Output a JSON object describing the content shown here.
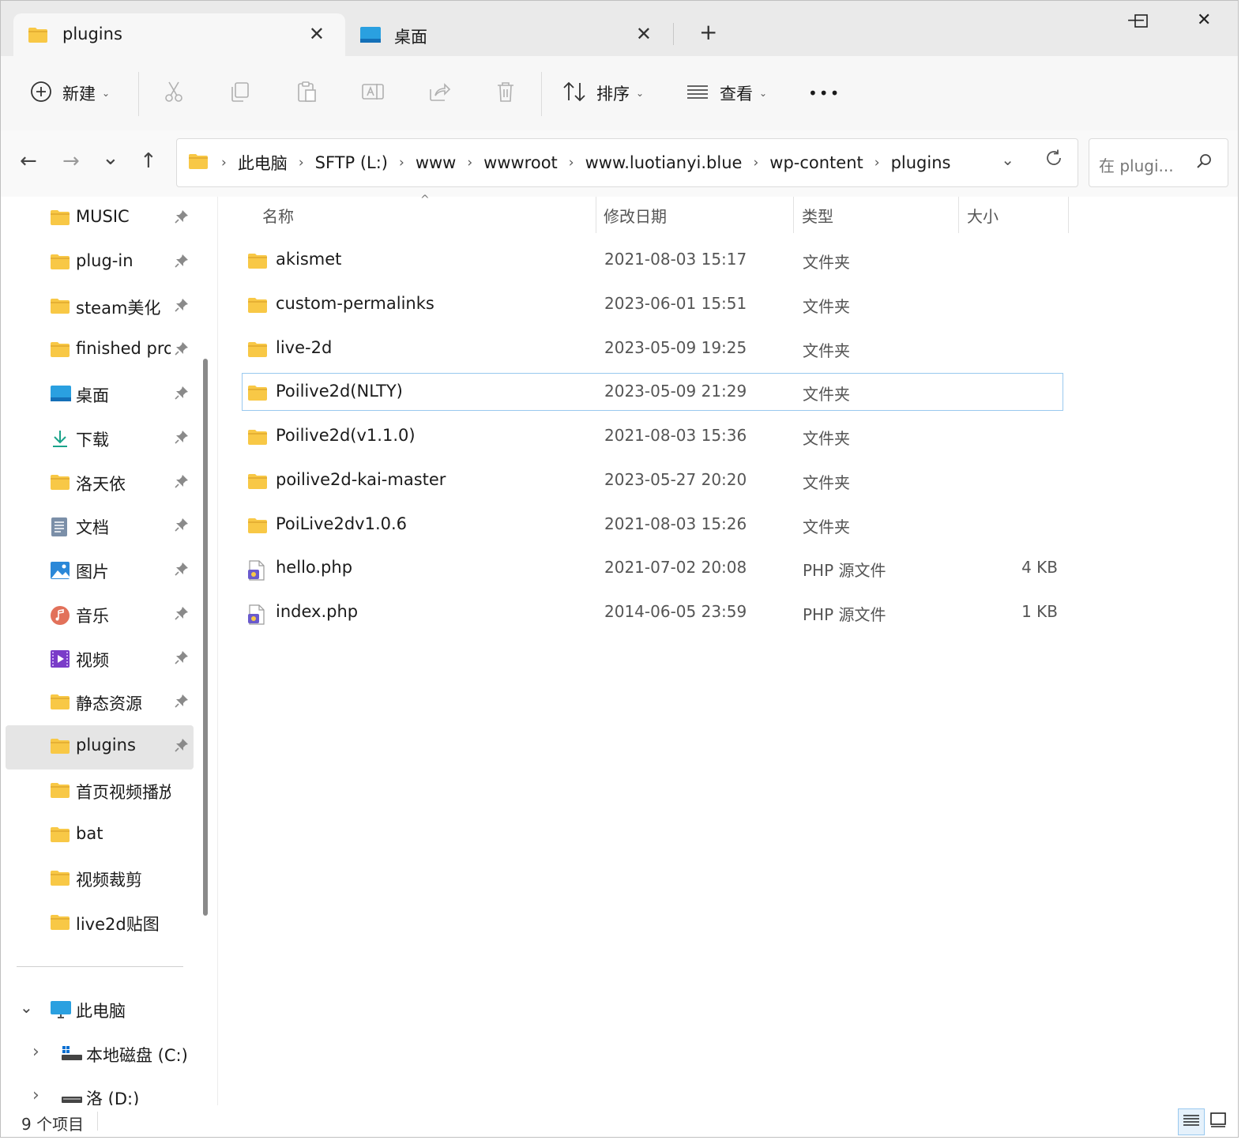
{
  "tabs": [
    {
      "label": "plugins",
      "close": "✕"
    },
    {
      "label": "桌面",
      "close": "✕"
    }
  ],
  "new_tab": "+",
  "window_controls": {
    "minimize": "—",
    "maximize": "☐",
    "close": "✕"
  },
  "toolbar": {
    "new_label": "新建",
    "sort_label": "排序",
    "view_label": "查看",
    "more": "•••",
    "icons": [
      "plus-circle-icon",
      "cut-icon",
      "copy-icon",
      "paste-icon",
      "rename-icon",
      "share-icon",
      "delete-icon"
    ]
  },
  "nav": {
    "back": "←",
    "forward": "→",
    "recent": "⌄",
    "up": "↑"
  },
  "breadcrumb": [
    "此电脑",
    "SFTP (L:)",
    "www",
    "wwwroot",
    "www.luotianyi.blue",
    "wp-content",
    "plugins"
  ],
  "search": {
    "placeholder": "在 plugi..."
  },
  "sidebar": {
    "quick_access": [
      {
        "label": "MUSIC",
        "icon": "folder-icon",
        "pinned": true
      },
      {
        "label": "plug-in",
        "icon": "folder-icon",
        "pinned": true
      },
      {
        "label": "steam美化",
        "icon": "folder-icon",
        "pinned": true
      },
      {
        "label": "finished proj",
        "icon": "folder-icon",
        "pinned": true
      },
      {
        "label": "桌面",
        "icon": "desktop-icon",
        "pinned": true
      },
      {
        "label": "下载",
        "icon": "download-icon",
        "pinned": true
      },
      {
        "label": "洛天依",
        "icon": "folder-icon",
        "pinned": true
      },
      {
        "label": "文档",
        "icon": "document-icon",
        "pinned": true
      },
      {
        "label": "图片",
        "icon": "pictures-icon",
        "pinned": true
      },
      {
        "label": "音乐",
        "icon": "music-icon",
        "pinned": true
      },
      {
        "label": "视频",
        "icon": "video-icon",
        "pinned": true
      },
      {
        "label": "静态资源",
        "icon": "folder-icon",
        "pinned": true
      },
      {
        "label": "plugins",
        "icon": "folder-icon",
        "pinned": true,
        "selected": true
      },
      {
        "label": "首页视频播放",
        "icon": "folder-icon",
        "pinned": false
      },
      {
        "label": "bat",
        "icon": "folder-icon",
        "pinned": false
      },
      {
        "label": "视频裁剪",
        "icon": "folder-icon",
        "pinned": false
      },
      {
        "label": "live2d贴图",
        "icon": "folder-icon",
        "pinned": false
      }
    ],
    "this_pc": {
      "label": "此电脑",
      "expander": "⌄"
    },
    "drives": [
      {
        "label": "本地磁盘 (C:)",
        "expander": "›"
      },
      {
        "label": "洛 (D:)",
        "expander": "›"
      }
    ]
  },
  "columns": {
    "name": "名称",
    "modified": "修改日期",
    "type": "类型",
    "size": "大小"
  },
  "files": [
    {
      "name": "akismet",
      "modified": "2021-08-03 15:17",
      "type": "文件夹",
      "size": "",
      "icon": "folder-icon"
    },
    {
      "name": "custom-permalinks",
      "modified": "2023-06-01 15:51",
      "type": "文件夹",
      "size": "",
      "icon": "folder-icon"
    },
    {
      "name": "live-2d",
      "modified": "2023-05-09 19:25",
      "type": "文件夹",
      "size": "",
      "icon": "folder-icon"
    },
    {
      "name": "Poilive2d(NLTY)",
      "modified": "2023-05-09 21:29",
      "type": "文件夹",
      "size": "",
      "icon": "folder-icon",
      "focused": true
    },
    {
      "name": "Poilive2d(v1.1.0)",
      "modified": "2021-08-03 15:36",
      "type": "文件夹",
      "size": "",
      "icon": "folder-icon"
    },
    {
      "name": "poilive2d-kai-master",
      "modified": "2023-05-27 20:20",
      "type": "文件夹",
      "size": "",
      "icon": "folder-icon"
    },
    {
      "name": "PoiLive2dv1.0.6",
      "modified": "2021-08-03 15:26",
      "type": "文件夹",
      "size": "",
      "icon": "folder-icon"
    },
    {
      "name": "hello.php",
      "modified": "2021-07-02 20:08",
      "type": "PHP 源文件",
      "size": "4 KB",
      "icon": "php-file-icon"
    },
    {
      "name": "index.php",
      "modified": "2014-06-05 23:59",
      "type": "PHP 源文件",
      "size": "1 KB",
      "icon": "php-file-icon"
    }
  ],
  "status": {
    "item_count": "9 个项目"
  },
  "colors": {
    "folder": "#f8c846",
    "folder_dark": "#e0a82e",
    "selection": "#e5e5e5",
    "focus_border": "#99c9ef"
  }
}
